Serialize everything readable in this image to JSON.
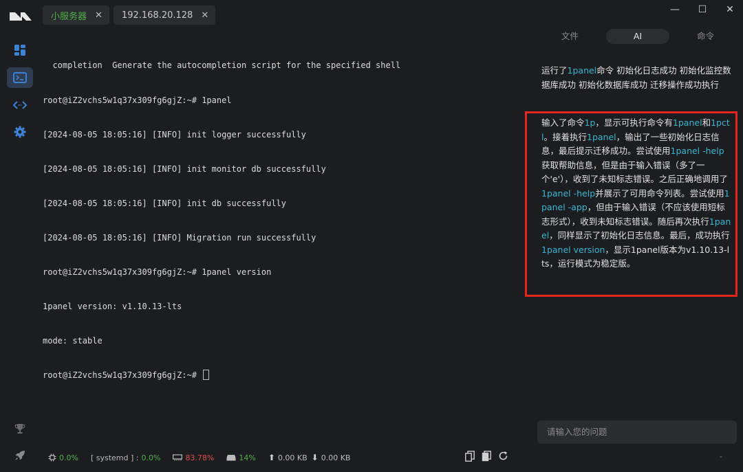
{
  "tabs": [
    {
      "label": "小服务器",
      "active": true
    },
    {
      "label": "192.168.20.128",
      "active": false
    }
  ],
  "window_controls": {
    "minimize": "—",
    "maximize": "☐",
    "close": "✕"
  },
  "terminal": {
    "lines": [
      "  completion  Generate the autocompletion script for the specified shell",
      "root@iZ2vchs5w1q37x309fg6gjZ:~# 1panel",
      "[2024-08-05 18:05:16] [INFO] init logger successfully",
      "[2024-08-05 18:05:16] [INFO] init monitor db successfully",
      "[2024-08-05 18:05:16] [INFO] init db successfully",
      "[2024-08-05 18:05:16] [INFO] Migration run successfully",
      "root@iZ2vchs5w1q37x309fg6gjZ:~# 1panel version",
      "1panel version: v1.10.13-lts",
      "mode: stable",
      "root@iZ2vchs5w1q37x309fg6gjZ:~# "
    ]
  },
  "right_panel": {
    "tabs": [
      "文件",
      "AI",
      "命令"
    ],
    "active_tab": "AI",
    "ai_summary_1": [
      {
        "t": "运行了",
        "kw": false
      },
      {
        "t": "1panel",
        "kw": true
      },
      {
        "t": "命令 初始化日志成功 初始化监控数据库成功 初始化数据库成功 迁移操作成功执行",
        "kw": false
      }
    ],
    "ai_summary_2": [
      {
        "t": "输入了命令",
        "kw": false
      },
      {
        "t": "1p",
        "kw": true
      },
      {
        "t": "，显示可执行命令有",
        "kw": false
      },
      {
        "t": "1panel",
        "kw": true
      },
      {
        "t": "和",
        "kw": false
      },
      {
        "t": "1pctl",
        "kw": true
      },
      {
        "t": "。接着执行",
        "kw": false
      },
      {
        "t": "1panel",
        "kw": true
      },
      {
        "t": "，输出了一些初始化日志信息，最后提示迁移成功。尝试使用",
        "kw": false
      },
      {
        "t": "1panel -help",
        "kw": true
      },
      {
        "t": "获取帮助信息，但是由于输入错误（多了一个'e'），收到了未知标志错误。之后正确地调用了",
        "kw": false
      },
      {
        "t": "1panel -help",
        "kw": true
      },
      {
        "t": "并展示了可用命令列表。尝试使用",
        "kw": false
      },
      {
        "t": "1panel -app",
        "kw": true
      },
      {
        "t": "，但由于输入错误（不应该使用短标志形式），收到未知标志错误。随后再次执行",
        "kw": false
      },
      {
        "t": "1panel",
        "kw": true
      },
      {
        "t": "，同样显示了初始化日志信息。最后，成功执行",
        "kw": false
      },
      {
        "t": "1panel version",
        "kw": true
      },
      {
        "t": "，显示1panel版本为v1.10.13-lts，运行模式为稳定版。",
        "kw": false
      }
    ],
    "ask_placeholder": "请输入您的问题"
  },
  "status_bar": {
    "cpu": "0.0%",
    "process_label": "[ systemd ] :",
    "process_value": "0.0%",
    "memory": "83.78%",
    "disk": "14%",
    "upload": "0.00 KB",
    "download": "0.00 KB",
    "dash": "-"
  },
  "colors": {
    "accent_green": "#4fb14a",
    "keyword_cyan": "#38b7d1",
    "highlight_red": "#e6261c",
    "memory_red": "#e24c4c"
  }
}
